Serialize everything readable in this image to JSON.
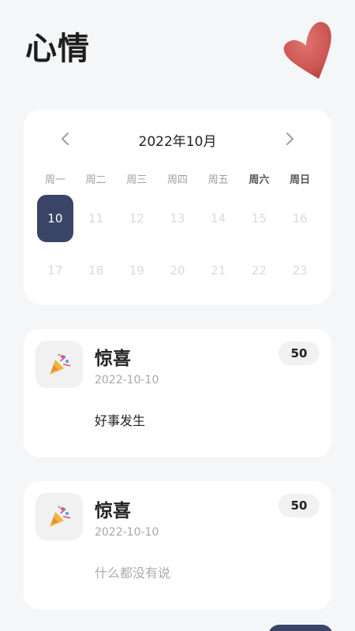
{
  "header": {
    "title": "心情",
    "heart_icon": "heart-icon"
  },
  "calendar": {
    "month_label": "2022年10月",
    "weekdays": [
      "周一",
      "周二",
      "周三",
      "周四",
      "周五",
      "周六",
      "周日"
    ],
    "days": [
      "10",
      "11",
      "12",
      "13",
      "14",
      "15",
      "16",
      "17",
      "18",
      "19",
      "20",
      "21",
      "22",
      "23"
    ],
    "selected_day": "10",
    "accent": "#3a4466"
  },
  "entries": [
    {
      "mood": "惊喜",
      "date": "2022-10-10",
      "score": "50",
      "note": "好事发生",
      "note_color": "#222222",
      "icon": "party-popper-icon"
    },
    {
      "mood": "惊喜",
      "date": "2022-10-10",
      "score": "50",
      "note": "什么都没有说",
      "note_color": "#a9abaf",
      "icon": "party-popper-icon"
    }
  ]
}
